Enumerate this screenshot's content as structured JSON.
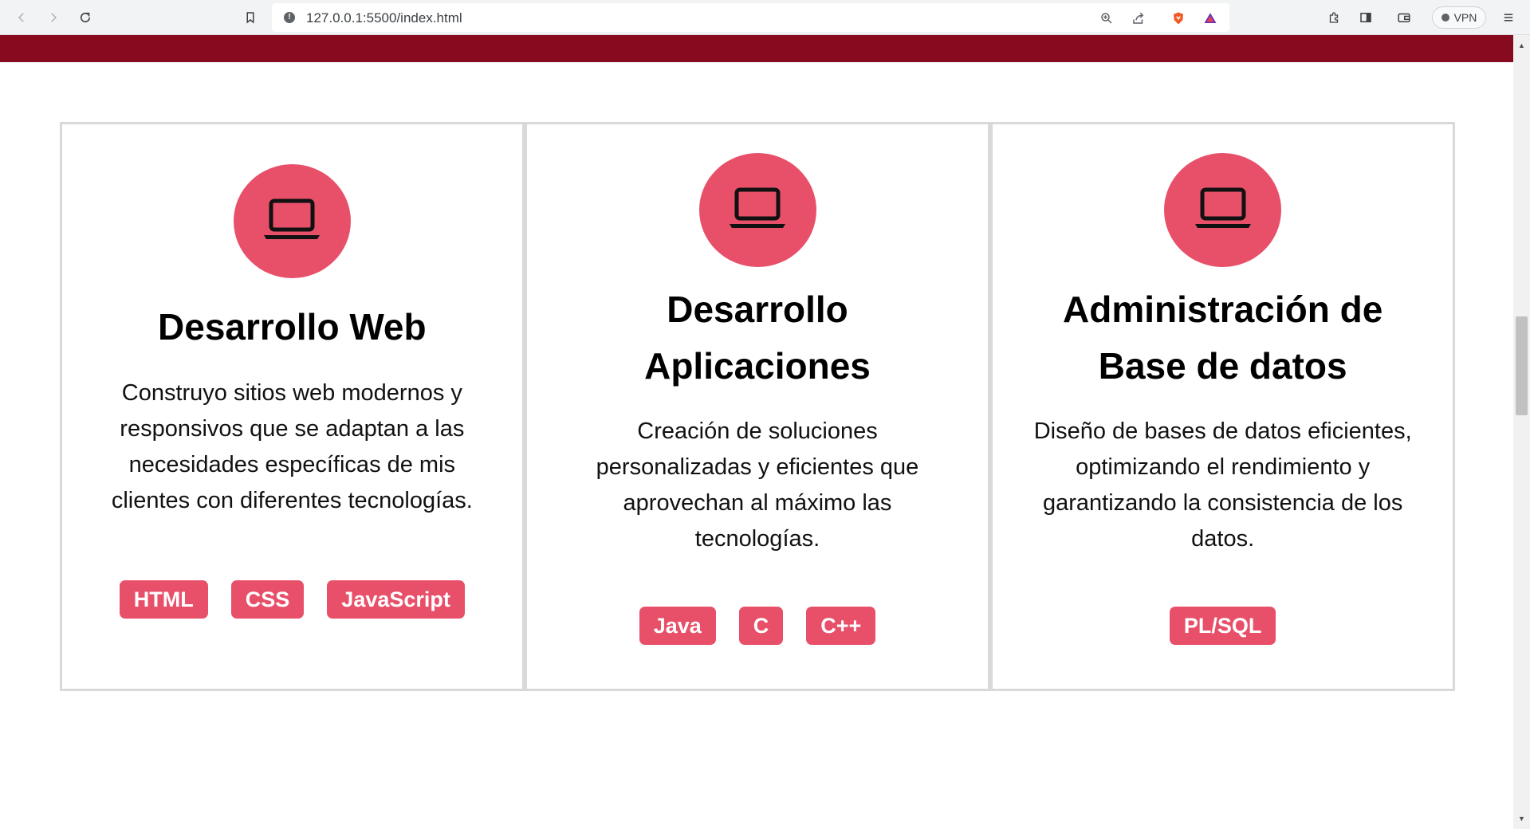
{
  "browser": {
    "url": "127.0.0.1:5500/index.html",
    "vpn_label": "VPN"
  },
  "colors": {
    "band": "#870a1f",
    "accent": "#e8506a",
    "card_border": "#d9d9d9"
  },
  "services": [
    {
      "icon": "laptop-icon",
      "title": "Desarrollo Web",
      "description": "Construyo sitios web modernos y responsivos que se adaptan a las necesidades específicas de mis clientes con diferentes tecnologías.",
      "tags": [
        "HTML",
        "CSS",
        "JavaScript"
      ]
    },
    {
      "icon": "laptop-icon",
      "title": "Desarrollo Aplicaciones",
      "description": "Creación de soluciones personalizadas y eficientes que aprovechan al máximo las tecnologías.",
      "tags": [
        "Java",
        "C",
        "C++"
      ]
    },
    {
      "icon": "laptop-icon",
      "title": "Administración de Base de datos",
      "description": "Diseño de bases de datos eficientes, optimizando el rendimiento y garantizando la consistencia de los datos.",
      "tags": [
        "PL/SQL"
      ]
    }
  ]
}
